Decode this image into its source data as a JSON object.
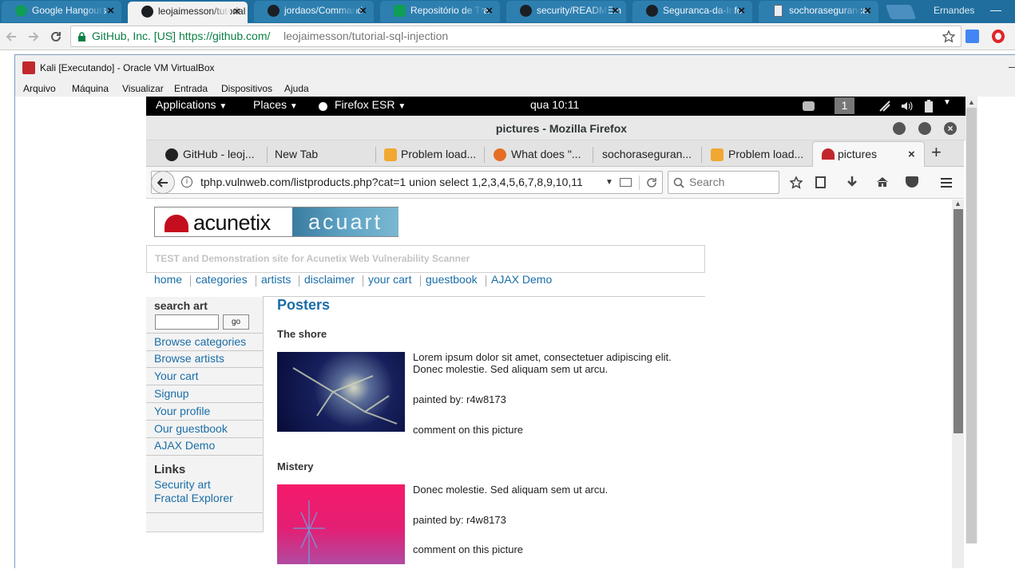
{
  "chrome": {
    "tabs": [
      {
        "title": "Google Hangouts",
        "icon": "hangouts-icon"
      },
      {
        "title": "leojaimesson/tutorial",
        "icon": "github-icon"
      },
      {
        "title": "jordaos/Command",
        "icon": "github-icon"
      },
      {
        "title": "Repositório de Tra",
        "icon": "sheets-icon"
      },
      {
        "title": "security/README.n",
        "icon": "github-icon"
      },
      {
        "title": "Seguranca-da-Info",
        "icon": "github-icon"
      },
      {
        "title": "sochoraseguranca",
        "icon": "document-icon"
      }
    ],
    "active_tab": 1,
    "profile_name": "Ernandes",
    "secure_label": "GitHub, Inc. [US]",
    "url_scheme_host": "https://github.com/",
    "url_path": "leojaimesson/tutorial-sql-injection"
  },
  "vbox": {
    "title": "Kali [Executando] - Oracle VM VirtualBox",
    "menu": [
      "Arquivo",
      "Máquina",
      "Visualizar",
      "Entrada",
      "Dispositivos",
      "Ajuda"
    ]
  },
  "gnome": {
    "applications": "Applications",
    "places": "Places",
    "firefox": "Firefox ESR",
    "clock": "qua 10:11",
    "workspace": "1"
  },
  "firefox": {
    "window_title": "pictures - Mozilla Firefox",
    "tabs": [
      {
        "title": "GitHub - leoj...",
        "icon": "github-icon"
      },
      {
        "title": "New Tab",
        "icon": ""
      },
      {
        "title": "Problem load...",
        "icon": "warning-icon"
      },
      {
        "title": "What does \"...",
        "icon": "firefox-icon"
      },
      {
        "title": "sochoraseguran...",
        "icon": ""
      },
      {
        "title": "Problem load...",
        "icon": "warning-icon"
      },
      {
        "title": "pictures",
        "icon": "acunetix-icon"
      }
    ],
    "url": "tphp.vulnweb.com/listproducts.php?cat=1 union select 1,2,3,4,5,6,7,8,9,10,11",
    "search_placeholder": "Search"
  },
  "site": {
    "logo_left": "acunetix",
    "logo_right": "acuart",
    "tagline": "TEST and Demonstration site for Acunetix Web Vulnerability Scanner",
    "nav": [
      "home",
      "categories",
      "artists",
      "disclaimer",
      "your cart",
      "guestbook",
      "AJAX Demo"
    ],
    "search_title": "search art",
    "search_button": "go",
    "sidebar": [
      "Browse categories",
      "Browse artists",
      "Your cart",
      "Signup",
      "Your profile",
      "Our guestbook",
      "AJAX Demo"
    ],
    "links_title": "Links",
    "links": [
      "Security art",
      "Fractal Explorer"
    ],
    "heading": "Posters",
    "products": [
      {
        "title": "The shore",
        "description_1": "Lorem ipsum dolor sit amet, consectetuer adipiscing elit.",
        "description_2": "Donec molestie. Sed aliquam sem ut arcu.",
        "painted_by_label": "painted by:",
        "artist": "r4w8173",
        "comment": "comment on this picture"
      },
      {
        "title": "Mistery",
        "description_1": "Donec molestie. Sed aliquam sem ut arcu.",
        "painted_by_label": "painted by:",
        "artist": "r4w8173",
        "comment": "comment on this picture"
      }
    ]
  }
}
